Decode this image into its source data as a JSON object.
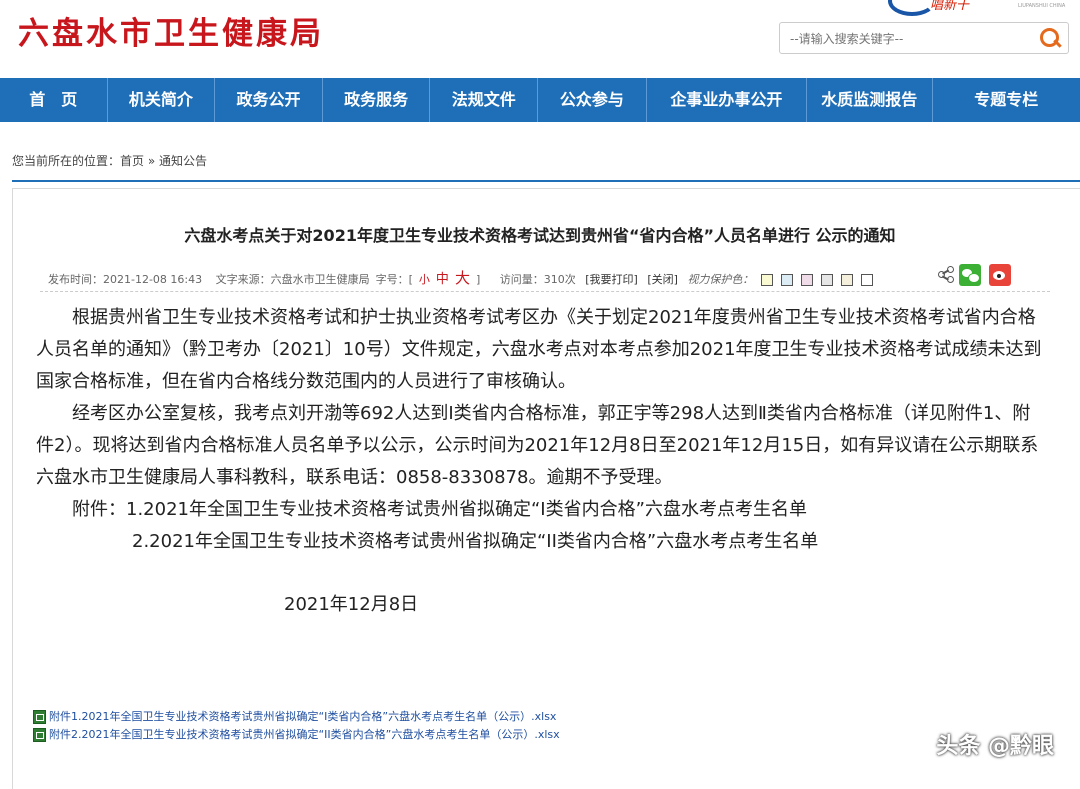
{
  "header": {
    "site_title": "六盘水市卫生健康局",
    "logo_text": "唱新干",
    "logo_sub": "LIUPANSHUI CHINA",
    "search_placeholder": "--请输入搜索关键字--"
  },
  "nav": {
    "items": [
      {
        "label": "首　页"
      },
      {
        "label": "机关简介"
      },
      {
        "label": "政务公开"
      },
      {
        "label": "政务服务"
      },
      {
        "label": "法规文件"
      },
      {
        "label": "公众参与"
      },
      {
        "label": "企事业办事公开"
      },
      {
        "label": "水质监测报告"
      },
      {
        "label": "专题专栏"
      }
    ]
  },
  "breadcrumb": {
    "prefix": "您当前所在的位置：",
    "home": "首页",
    "sep": " » ",
    "current": "通知公告"
  },
  "article": {
    "title": "六盘水考点关于对2021年度卫生专业技术资格考试达到贵州省“省内合格”人员名单进行 公示的通知",
    "meta": {
      "publish_time": "发布时间：2021-12-08 16:43",
      "source": "文字来源：六盘水市卫生健康局",
      "font_size_label": "字号：[",
      "font_small": "小",
      "font_mid": "中",
      "font_big": "大",
      "font_close": "]",
      "views": "访问量：310次",
      "print": "[我要打印]",
      "close": "[关闭]",
      "vision_label": "视力保护色：",
      "swatches": [
        "#fafad2",
        "#dcecf4",
        "#f0dce8",
        "#e6e6e6",
        "#f4f0dc",
        "#ffffff"
      ]
    },
    "paragraphs": [
      "根据贵州省卫生专业技术资格考试和护士执业资格考试考区办《关于划定2021年度贵州省卫生专业技术资格考试省内合格人员名单的通知》（黔卫考办〔2021〕10号）文件规定，六盘水考点对本考点参加2021年度卫生专业技术资格考试成绩未达到国家合格标准，但在省内合格线分数范围内的人员进行了审核确认。",
      "经考区办公室复核，我考点刘开渤等692人达到Ⅰ类省内合格标准，郭正宇等298人达到Ⅱ类省内合格标准（详见附件1、附件2）。现将达到省内合格标准人员名单予以公示，公示时间为2021年12月8日至2021年12月15日，如有异议请在公示期联系六盘水市卫生健康局人事科教科，联系电话：0858-8330878。逾期不予受理。"
    ],
    "attachment_line1": "附件：1.2021年全国卫生专业技术资格考试贵州省拟确定“I类省内合格”六盘水考点考生名单",
    "attachment_line2": "2.2021年全国卫生专业技术资格考试贵州省拟确定“II类省内合格”六盘水考点考生名单",
    "date": "2021年12月8日",
    "files": [
      {
        "label": "附件1.2021年全国卫生专业技术资格考试贵州省拟确定“I类省内合格”六盘水考点考生名单（公示）.xlsx"
      },
      {
        "label": "附件2.2021年全国卫生专业技术资格考试贵州省拟确定“II类省内合格”六盘水考点考生名单（公示）.xlsx"
      }
    ]
  },
  "watermark": "头条 @黔眼"
}
